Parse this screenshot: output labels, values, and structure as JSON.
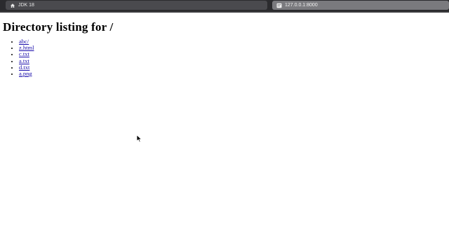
{
  "browser": {
    "tabs": [
      {
        "label": "JDK 18",
        "icon": "home-icon"
      },
      {
        "label": "127.0.0.1:8000",
        "icon": "page-icon"
      }
    ]
  },
  "page": {
    "heading": "Directory listing for /",
    "entries": [
      {
        "name": "abc/"
      },
      {
        "name": "z.html"
      },
      {
        "name": "c.txt"
      },
      {
        "name": "a.txt"
      },
      {
        "name": "d.txt"
      },
      {
        "name": "a.png"
      }
    ]
  },
  "colors": {
    "link": "#1a0dab",
    "visited": "#551a8b",
    "topbar": "#2b2b2e"
  }
}
